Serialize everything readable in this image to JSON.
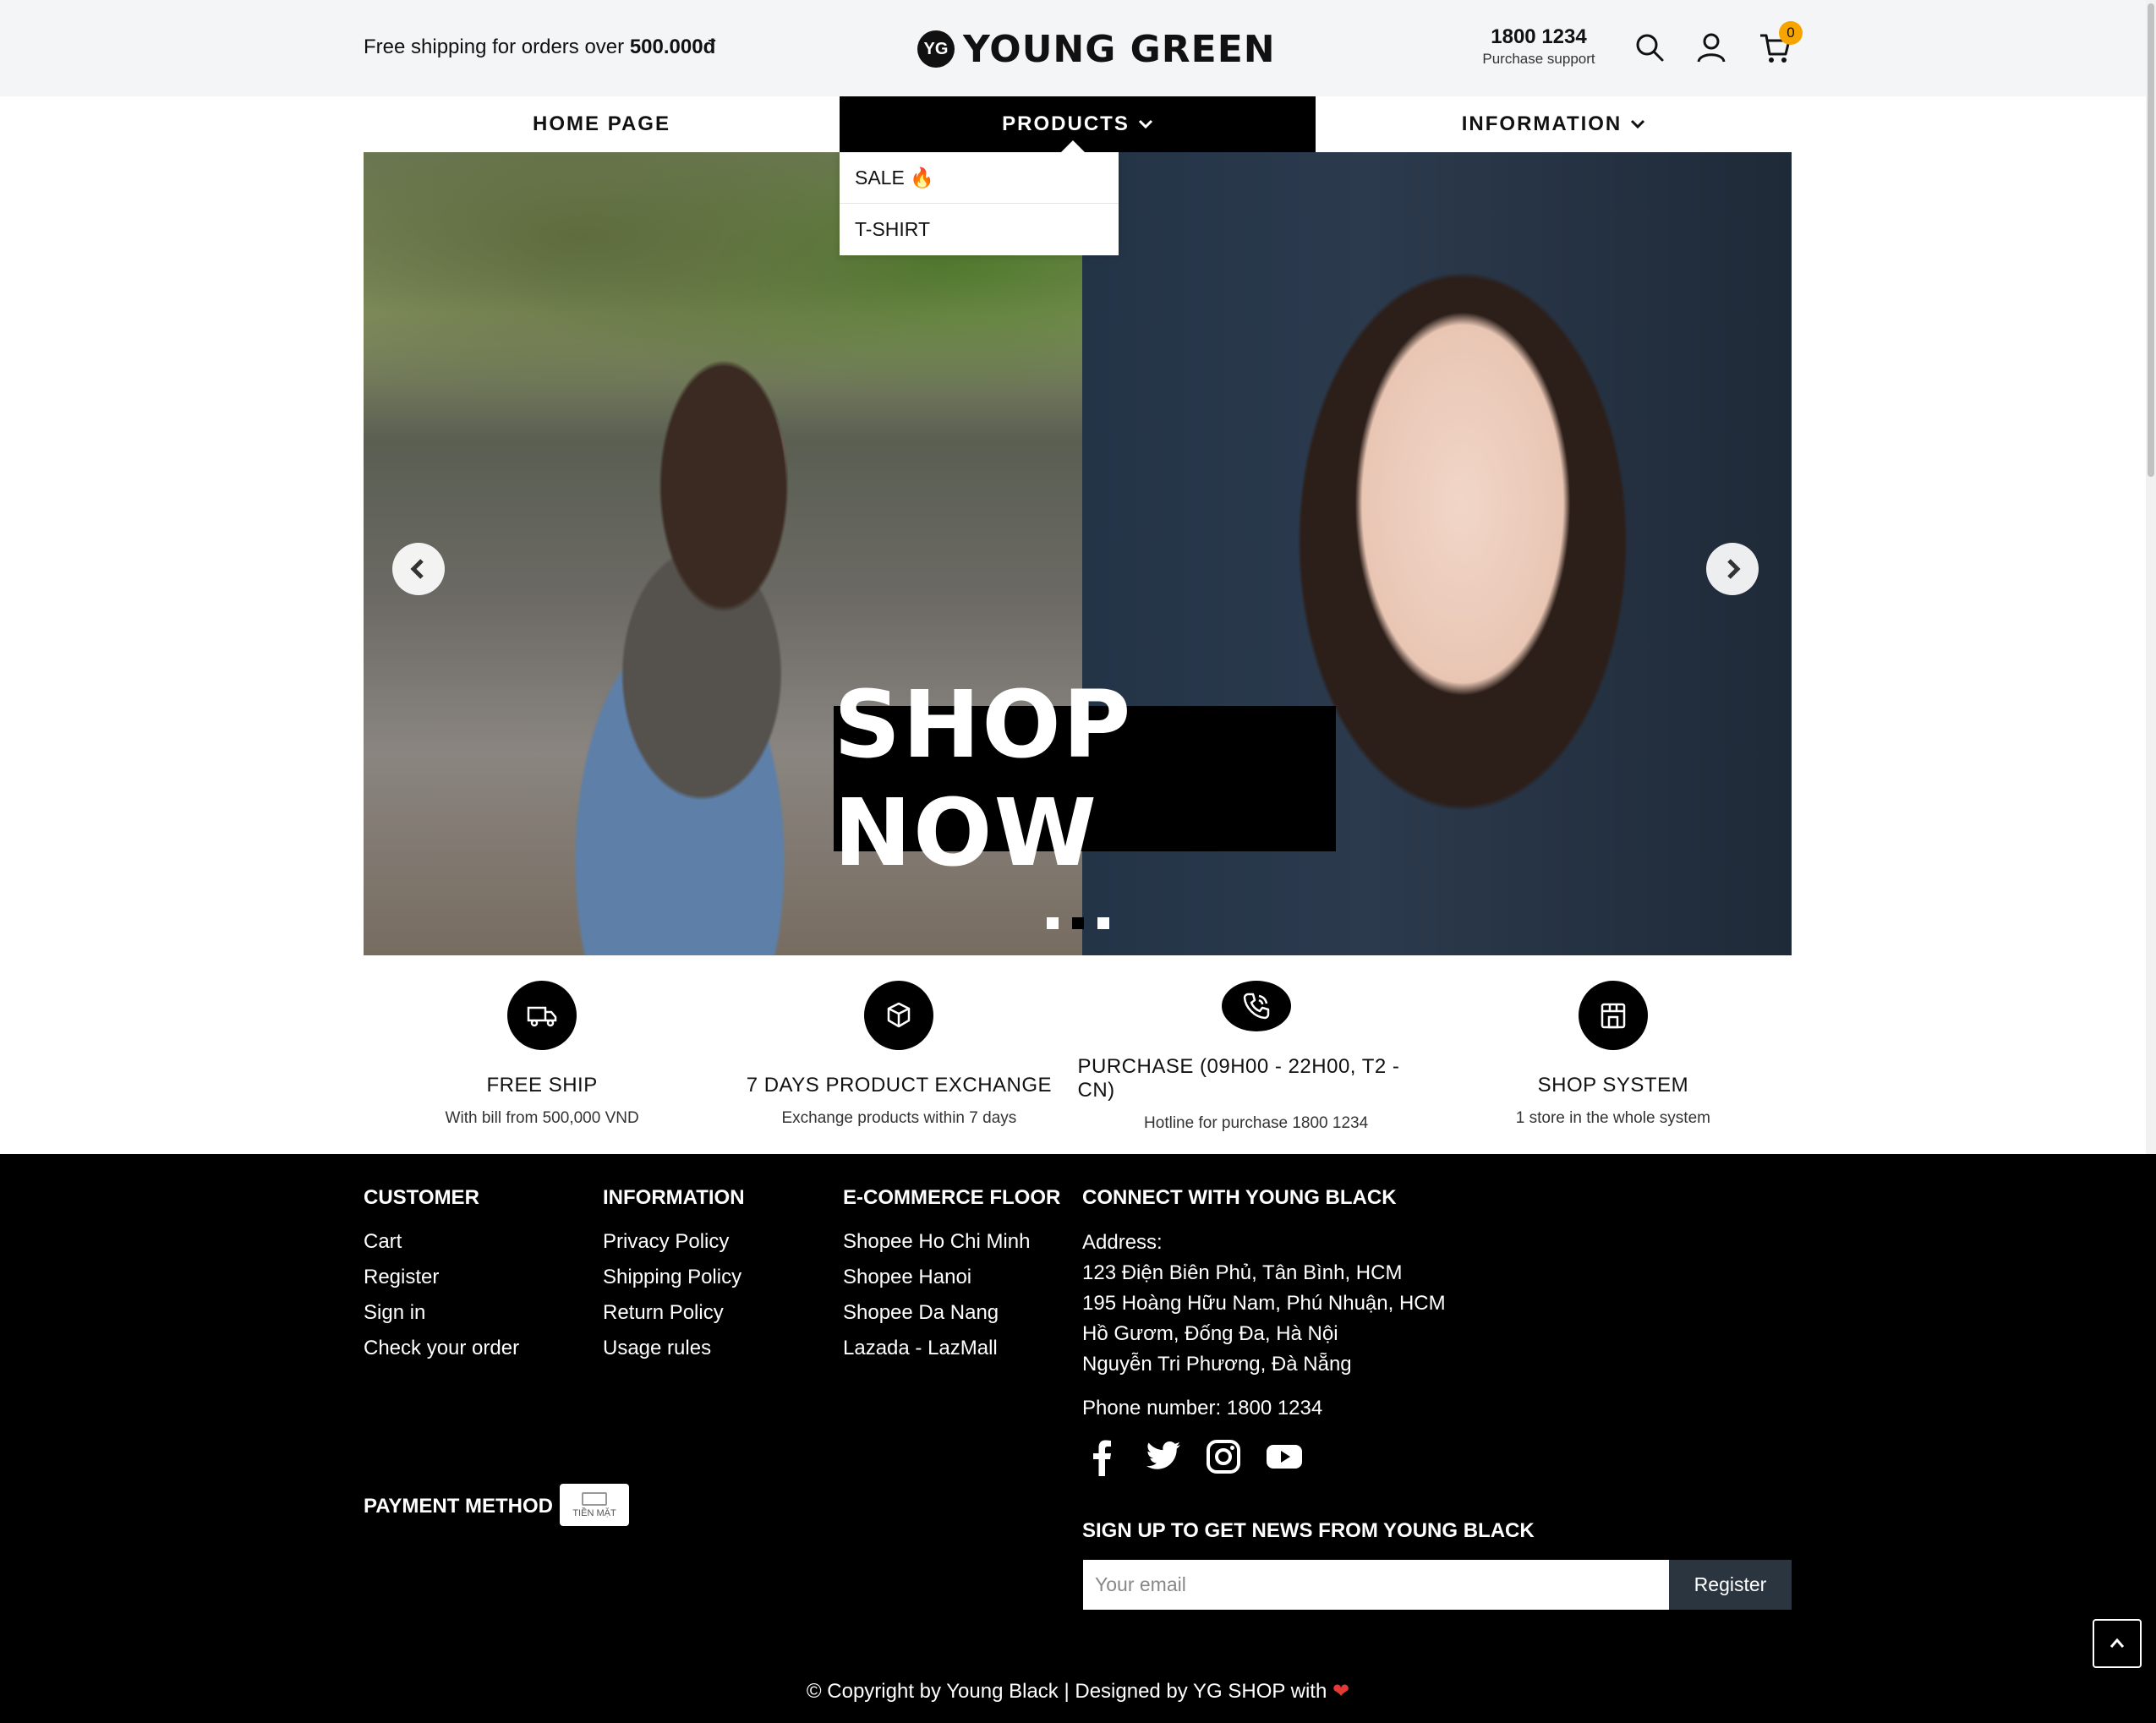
{
  "header": {
    "free_ship_text": "Free shipping for orders over ",
    "free_ship_amount": "500.000đ",
    "logo_mark": "YG",
    "logo_text": "YOUNG GREEN",
    "phone": "1800 1234",
    "phone_label": "Purchase support",
    "cart_count": "0",
    "icons": [
      "search-icon",
      "user-icon",
      "cart-icon"
    ]
  },
  "nav": {
    "items": [
      {
        "label": "HOME PAGE",
        "active": false,
        "has_dropdown": false
      },
      {
        "label": "PRODUCTS",
        "active": true,
        "has_dropdown": true
      },
      {
        "label": "INFORMATION",
        "active": false,
        "has_dropdown": true
      }
    ],
    "dropdown": [
      "SALE 🔥",
      "T-SHIRT"
    ]
  },
  "banner": {
    "cta": "SHOP NOW",
    "slides": 3,
    "active_slide": 2
  },
  "features": [
    {
      "icon": "truck-icon",
      "title": "FREE SHIP",
      "subtitle": "With bill from 500,000 VND"
    },
    {
      "icon": "box-exchange-icon",
      "title": "7 DAYS PRODUCT EXCHANGE",
      "subtitle": "Exchange products within 7 days"
    },
    {
      "icon": "phone-call-icon",
      "title": "PURCHASE (09H00 - 22H00, T2 - CN)",
      "subtitle": "Hotline for purchase 1800 1234"
    },
    {
      "icon": "store-icon",
      "title": "SHOP SYSTEM",
      "subtitle": "1 store in the whole system"
    }
  ],
  "footer": {
    "customer": {
      "title": "CUSTOMER",
      "links": [
        "Cart",
        "Register",
        "Sign in",
        "Check your order"
      ]
    },
    "information": {
      "title": "INFORMATION",
      "links": [
        "Privacy Policy",
        "Shipping Policy",
        "Return Policy",
        "Usage rules"
      ]
    },
    "ecommerce": {
      "title": "E-COMMERCE FLOOR",
      "links": [
        "Shopee Ho Chi Minh",
        "Shopee Hanoi",
        "Shopee Da Nang",
        "Lazada - LazMall"
      ]
    },
    "connect": {
      "title": "CONNECT WITH YOUNG BLACK",
      "address_label": "Address:",
      "addresses": [
        "123 Điện Biên Phủ, Tân Bình, HCM",
        "195 Hoàng Hữu Nam, Phú Nhuận, HCM",
        "Hồ Gươm, Đống Đa, Hà Nội",
        "Nguyễn Tri Phương, Đà Nẵng"
      ],
      "phone": "Phone number: 1800 1234",
      "socials": [
        "facebook-icon",
        "twitter-icon",
        "instagram-icon",
        "youtube-icon"
      ]
    },
    "payment_label": "PAYMENT METHOD",
    "payment_badge": "TIỀN MẶT",
    "signup_title": "SIGN UP TO GET NEWS FROM YOUNG BLACK",
    "email_placeholder": "Your email",
    "register_label": "Register",
    "copyright": "© Copyright by Young Black | Designed by YG SHOP with ",
    "heart": "❤"
  }
}
